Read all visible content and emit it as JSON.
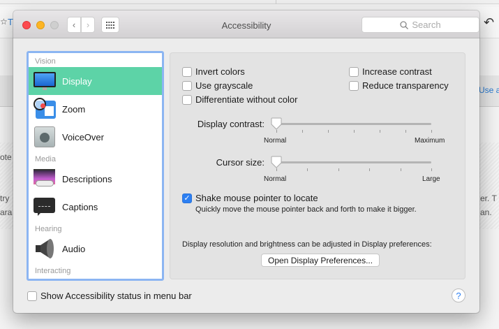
{
  "background": {
    "left_link": "T",
    "right_link": "Use ad",
    "fragments_left": [
      "ote",
      "try",
      "ara"
    ],
    "fragments_right": [
      "er. T",
      "an."
    ]
  },
  "window": {
    "title": "Accessibility",
    "search_placeholder": "Search"
  },
  "sidebar": {
    "items": [
      {
        "type": "section",
        "label": "Vision"
      },
      {
        "type": "item",
        "label": "Display",
        "icon": "display-icon",
        "selected": true
      },
      {
        "type": "item",
        "label": "Zoom",
        "icon": "zoom-icon"
      },
      {
        "type": "item",
        "label": "VoiceOver",
        "icon": "voiceover-icon"
      },
      {
        "type": "section",
        "label": "Media"
      },
      {
        "type": "item",
        "label": "Descriptions",
        "icon": "descriptions-icon"
      },
      {
        "type": "item",
        "label": "Captions",
        "icon": "captions-icon"
      },
      {
        "type": "section",
        "label": "Hearing"
      },
      {
        "type": "item",
        "label": "Audio",
        "icon": "audio-icon"
      },
      {
        "type": "section",
        "label": "Interacting"
      }
    ]
  },
  "display": {
    "invert_colors": {
      "label": "Invert colors",
      "checked": false
    },
    "use_grayscale": {
      "label": "Use grayscale",
      "checked": false
    },
    "differentiate": {
      "label": "Differentiate without color",
      "checked": false
    },
    "increase_contrast": {
      "label": "Increase contrast",
      "checked": false
    },
    "reduce_transparency": {
      "label": "Reduce transparency",
      "checked": false
    },
    "contrast": {
      "label": "Display contrast:",
      "min_label": "Normal",
      "max_label": "Maximum",
      "value": 0
    },
    "cursor": {
      "label": "Cursor size:",
      "min_label": "Normal",
      "max_label": "Large",
      "value": 0
    },
    "shake": {
      "label": "Shake mouse pointer to locate",
      "checked": true,
      "description": "Quickly move the mouse pointer back and forth to make it bigger."
    },
    "resolution_note": "Display resolution and brightness can be adjusted in Display preferences:",
    "open_prefs_button": "Open Display Preferences..."
  },
  "footer": {
    "show_status": {
      "label": "Show Accessibility status in menu bar",
      "checked": false
    },
    "help": "?"
  }
}
